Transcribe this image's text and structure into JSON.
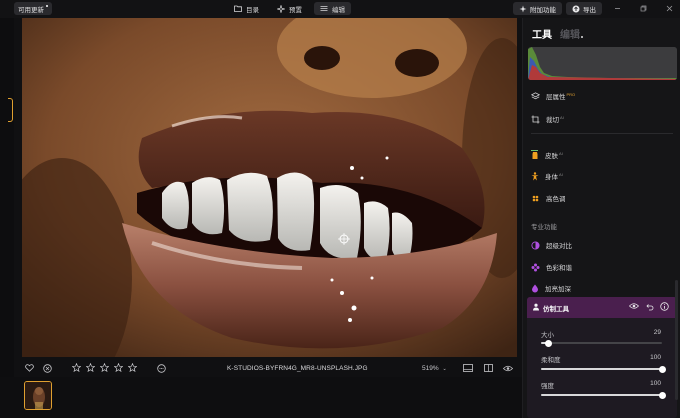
{
  "topbar": {
    "update_label": "可用更新",
    "tabs": [
      {
        "label": "目录",
        "icon": "folder-icon"
      },
      {
        "label": "预置",
        "icon": "sparkle-icon"
      },
      {
        "label": "编辑",
        "icon": "sliders-icon"
      }
    ],
    "addons_label": "附加功能",
    "export_label": "导出"
  },
  "panel": {
    "tab_tools": "工具",
    "tab_edit": "编辑",
    "items_basic": [
      {
        "label": "层属性",
        "sup": "PRO",
        "icon": "layers-icon"
      },
      {
        "label": "裁切",
        "sup": "AI",
        "icon": "crop-icon"
      }
    ],
    "items_portrait": [
      {
        "label": "皮肤",
        "sup": "AI",
        "icon": "skin-icon",
        "color": "#f0a020"
      },
      {
        "label": "身体",
        "sup": "AI",
        "icon": "body-icon",
        "color": "#f0a020"
      },
      {
        "label": "高色调",
        "sup": "",
        "icon": "palette-icon",
        "color": "#f0a020"
      }
    ],
    "pro_section": "专业功能",
    "items_pro": [
      {
        "label": "超级对比",
        "icon": "contrast-icon",
        "color": "#b050e0"
      },
      {
        "label": "色彩和谐",
        "icon": "flower-icon",
        "color": "#b050e0"
      },
      {
        "label": "加亮加深",
        "icon": "drop-icon",
        "color": "#b050e0"
      }
    ],
    "clone": {
      "title": "仿制工具",
      "sliders": [
        {
          "label": "大小",
          "value": "29",
          "fraction": 0.06
        },
        {
          "label": "柔和度",
          "value": "100",
          "fraction": 1.0
        },
        {
          "label": "强度",
          "value": "100",
          "fraction": 1.0
        }
      ]
    }
  },
  "photo_toolbar": {
    "filename": "K-STUDIOS-BYFRN4G_MR8-UNSPLASH.JPG",
    "zoom": "519%",
    "rating_stars": 5
  },
  "colors": {
    "accent_orange": "#e0a030",
    "accent_purple": "#b050e0",
    "clone_header": "#4a1f4e"
  }
}
